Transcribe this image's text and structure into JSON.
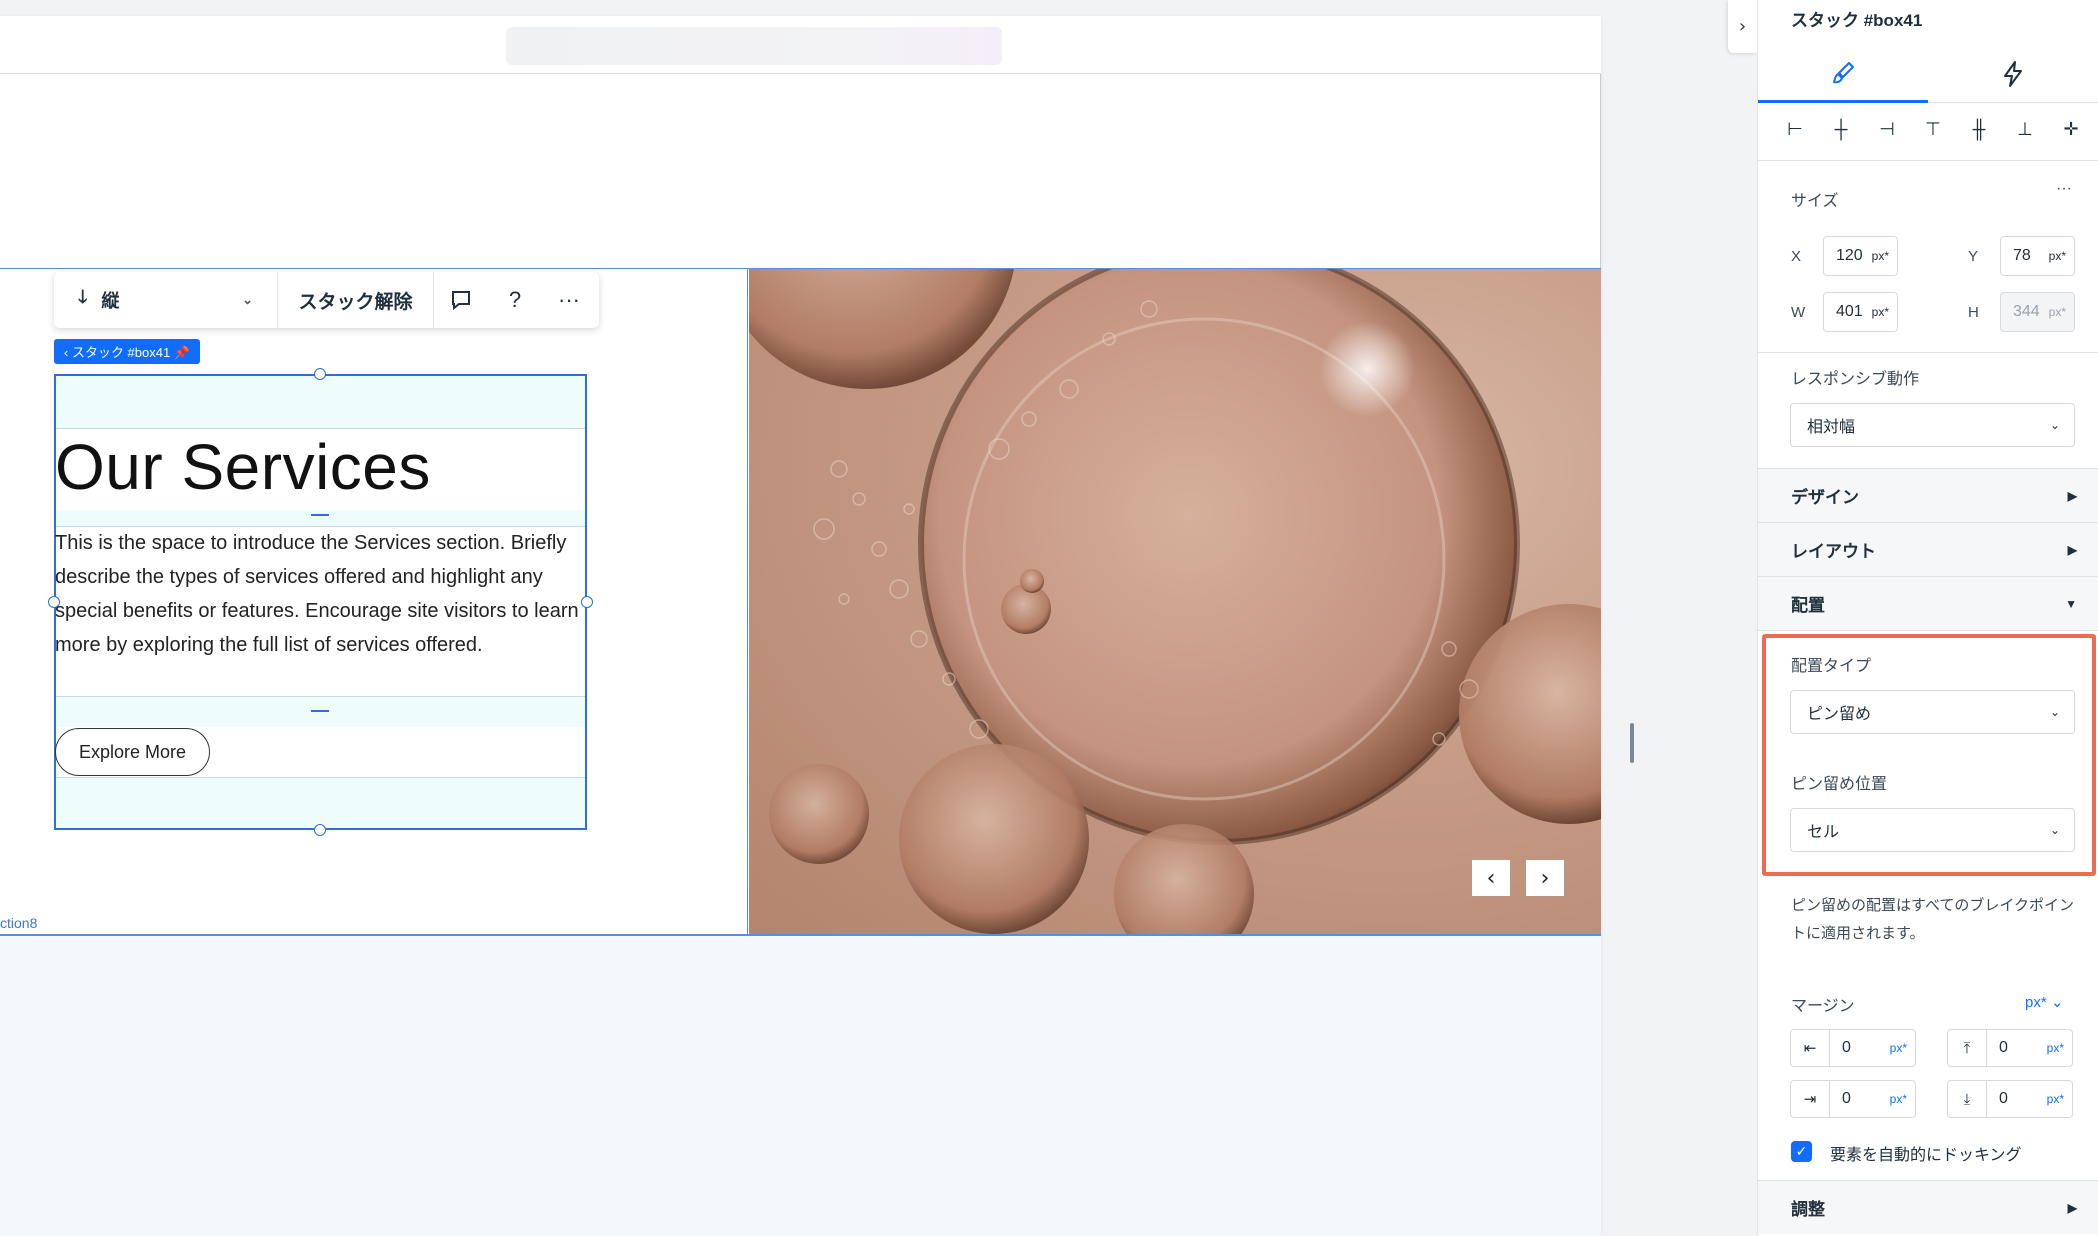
{
  "toolbar": {
    "direction_label": "縦",
    "unstack_label": "スタック解除",
    "stack_tag": "‹ スタック #box41 📌"
  },
  "content": {
    "title": "Our Services",
    "body": "This is the space to introduce the Services section. Briefly describe the types of services offered and highlight any special benefits or features. Encourage site visitors to learn more by exploring the full list of services offered.",
    "button_label": "Explore More",
    "section_label": "ction8"
  },
  "inspector": {
    "title": "スタック #box41",
    "size_label": "サイズ",
    "more_label": "···",
    "x_label": "X",
    "x_value": "120",
    "y_label": "Y",
    "y_value": "78",
    "w_label": "W",
    "w_value": "401",
    "h_label": "H",
    "h_value": "344",
    "unit": "px*",
    "responsive_label": "レスポンシブ動作",
    "responsive_value": "相対幅",
    "design_header": "デザイン",
    "layout_header": "レイアウト",
    "placement_header": "配置",
    "placement_type_label": "配置タイプ",
    "placement_type_value": "ピン留め",
    "pin_position_label": "ピン留め位置",
    "pin_position_value": "セル",
    "pin_note": "ピン留めの配置はすべてのブレイクポイントに適用されます。",
    "margin_label": "マージン",
    "margin_unit": "px*",
    "margins": [
      "0",
      "0",
      "0",
      "0"
    ],
    "dock_label": "要素を自動的にドッキング",
    "adjust_header": "調整"
  },
  "colors": {
    "accent": "#116dff",
    "highlight": "#ee6b50",
    "selection": "#2c6fd6"
  }
}
